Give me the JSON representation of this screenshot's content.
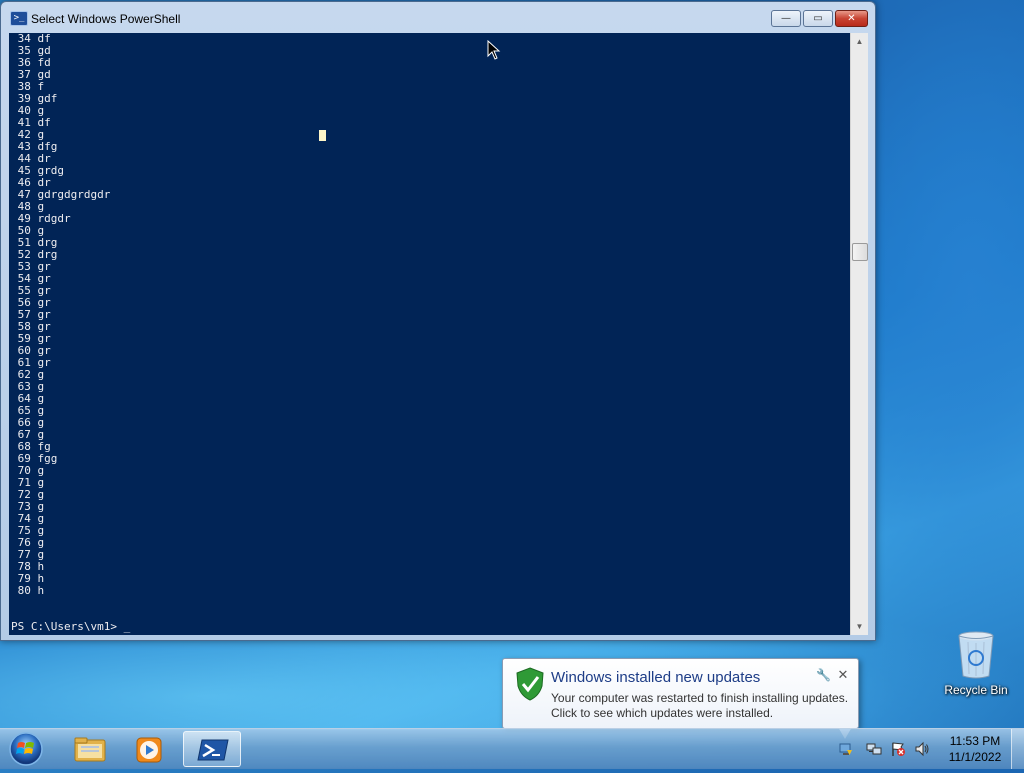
{
  "window": {
    "title": "Select Windows PowerShell",
    "icon_glyph": ">_",
    "buttons": {
      "minimize": "—",
      "maximize": "▭",
      "close": "✕"
    }
  },
  "console": {
    "lines": [
      " 34 df",
      " 35 gd",
      " 36 fd",
      " 37 gd",
      " 38 f",
      " 39 gdf",
      " 40 g",
      " 41 df",
      " 42 g",
      " 43 dfg",
      " 44 dr",
      " 45 grdg",
      " 46 dr",
      " 47 gdrgdgrdgdr",
      " 48 g",
      " 49 rdgdr",
      " 50 g",
      " 51 drg",
      " 52 drg",
      " 53 gr",
      " 54 gr",
      " 55 gr",
      " 56 gr",
      " 57 gr",
      " 58 gr",
      " 59 gr",
      " 60 gr",
      " 61 gr",
      " 62 g",
      " 63 g",
      " 64 g",
      " 65 g",
      " 66 g",
      " 67 g",
      " 68 fg",
      " 69 fgg",
      " 70 g",
      " 71 g",
      " 72 g",
      " 73 g",
      " 74 g",
      " 75 g",
      " 76 g",
      " 77 g",
      " 78 h",
      " 79 h",
      " 80 h"
    ],
    "prompt": "PS C:\\Users\\vm1> _",
    "colors": {
      "background": "#012456",
      "foreground": "#eeedf0"
    }
  },
  "desktop": {
    "recycle_bin_label": "Recycle Bin"
  },
  "notification": {
    "title": "Windows installed new updates",
    "body_line1": "Your computer was restarted to finish installing updates.",
    "body_line2": "Click to see which updates were installed.",
    "options_icon": "🔧",
    "close_glyph": "✕"
  },
  "taskbar": {
    "pinned": [
      "start-orb",
      "windows-explorer",
      "windows-media-player",
      "windows-powershell"
    ],
    "active": "windows-powershell",
    "tray_icons": [
      "windows-update-icon",
      "network-icon",
      "action-center-flag-icon",
      "volume-icon"
    ],
    "clock": {
      "time": "11:53 PM",
      "date": "11/1/2022"
    }
  }
}
